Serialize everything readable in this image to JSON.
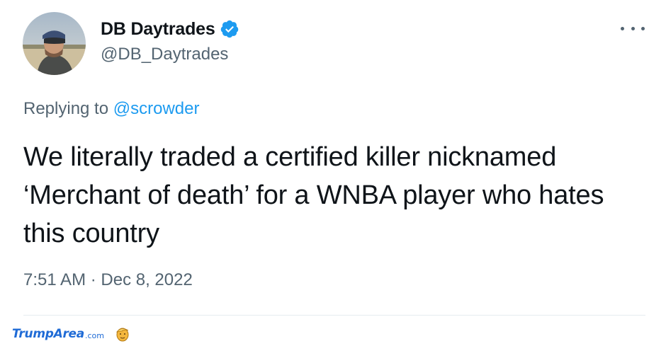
{
  "author": {
    "display_name": "DB Daytrades",
    "handle": "@DB_Daytrades",
    "verified": true,
    "avatar": "profile-photo"
  },
  "reply": {
    "prefix": "Replying to ",
    "mention": "@scrowder"
  },
  "tweet": {
    "text": "We literally traded a certified killer nicknamed ‘Merchant of death’ for a WNBA player who hates this country",
    "timestamp": "7:51 AM · Dec 8, 2022"
  },
  "watermark": {
    "brand": "TrumpArea",
    "suffix": ".com",
    "icon": "trump-face-icon"
  },
  "icons": {
    "verified": "verified-badge-icon",
    "more": "more-options-icon"
  },
  "colors": {
    "text": "#0f1419",
    "secondary": "#536471",
    "accent": "#1d9bf0",
    "watermark": "#1f6bd6"
  }
}
